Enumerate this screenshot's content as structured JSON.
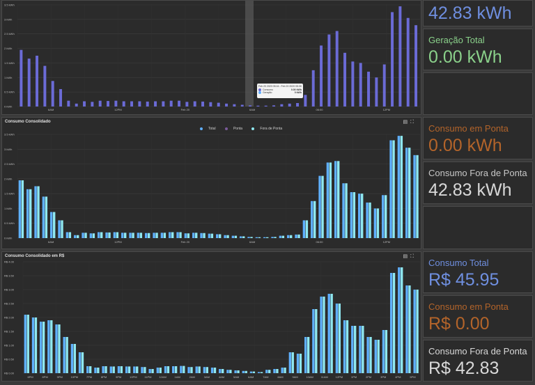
{
  "chart1": {
    "title": "",
    "tooltip": {
      "time": "Feb 20 2020 05:16 - Feb 20 2020 05:30",
      "rows": [
        {
          "name": "Consumo",
          "value": "0.00 kWh",
          "color": "#6b6bd6"
        },
        {
          "name": "Geração",
          "value": "0 kWh",
          "color": "#5fb0ff"
        }
      ]
    },
    "chart_data": {
      "type": "bar",
      "ylim": [
        0,
        3.5
      ],
      "yticks": [
        "0 kWh",
        "0.5 kWh",
        "1 kWh",
        "1.5 kWh",
        "2 kWh",
        "2.5 kWh",
        "3 kWh",
        "3.5 kWh"
      ],
      "xticks": [
        "6AM",
        "12PM",
        "Feb 20",
        "6AM",
        "06:00",
        "12PM"
      ],
      "series": [
        {
          "name": "Consumo",
          "color": "#6b6bd6",
          "values": [
            1.95,
            1.65,
            1.75,
            1.4,
            0.88,
            0.6,
            0.2,
            0.1,
            0.18,
            0.16,
            0.2,
            0.19,
            0.2,
            0.18,
            0.18,
            0.18,
            0.17,
            0.18,
            0.18,
            0.2,
            0.2,
            0.16,
            0.18,
            0.17,
            0.15,
            0.13,
            0.1,
            0.08,
            0.06,
            0.04,
            0.03,
            0.03,
            0.04,
            0.08,
            0.1,
            0.12,
            0.4,
            1.25,
            2.1,
            2.48,
            2.6,
            1.85,
            1.55,
            1.5,
            1.2,
            1.0,
            1.45,
            3.25,
            3.45,
            3.05,
            2.8
          ]
        }
      ]
    }
  },
  "chart2": {
    "title": "Consumo Consolidado",
    "legend": [
      {
        "name": "Total",
        "color": "#5fb0ff"
      },
      {
        "name": "Ponta",
        "color": "#7a5a9a"
      },
      {
        "name": "Fora de Ponta",
        "color": "#8fe8f0"
      }
    ],
    "chart_data": {
      "type": "bar",
      "ylim": [
        0,
        3.5
      ],
      "yticks": [
        "0 kWh",
        "0.5 kWh",
        "1 kWh",
        "1.5 kWh",
        "2 kWh",
        "2.5 kWh",
        "3 kWh",
        "3.5 kWh"
      ],
      "xticks": [
        "6AM",
        "12PM",
        "Feb 20",
        "6AM",
        "06:00",
        "12PM"
      ],
      "values": [
        1.95,
        1.65,
        1.75,
        1.4,
        0.88,
        0.6,
        0.2,
        0.1,
        0.18,
        0.16,
        0.2,
        0.19,
        0.2,
        0.18,
        0.18,
        0.18,
        0.17,
        0.18,
        0.18,
        0.2,
        0.2,
        0.16,
        0.18,
        0.17,
        0.15,
        0.13,
        0.1,
        0.08,
        0.06,
        0.04,
        0.03,
        0.03,
        0.04,
        0.08,
        0.1,
        0.12,
        0.6,
        1.25,
        2.1,
        2.55,
        2.6,
        1.85,
        1.55,
        1.5,
        1.2,
        1.0,
        1.45,
        3.3,
        3.45,
        3.05,
        2.8
      ]
    }
  },
  "chart3": {
    "title": "Consumo Consolidado em R$",
    "chart_data": {
      "type": "bar",
      "ylim": [
        0,
        4
      ],
      "yticks": [
        "R$ 0.00",
        "R$ 0.50",
        "R$ 1.00",
        "R$ 1.50",
        "R$ 2.00",
        "R$ 2.50",
        "R$ 3.00",
        "R$ 3.50",
        "R$ 4.00"
      ],
      "xticks": [
        "6PM",
        "8PM",
        "9PM",
        "10PM",
        "7PM",
        "8PM",
        "9PM",
        "10PM",
        "11PM",
        "12AM",
        "1AM",
        "2AM",
        "3AM",
        "4AM",
        "5AM",
        "6AM",
        "7AM",
        "8AM",
        "9AM",
        "10AM",
        "11AM",
        "12PM",
        "1PM",
        "2PM",
        "3PM",
        "4PM",
        "5PM"
      ],
      "values": [
        2.1,
        2.0,
        1.85,
        1.9,
        1.75,
        1.3,
        1.05,
        0.75,
        0.25,
        0.2,
        0.25,
        0.24,
        0.25,
        0.24,
        0.24,
        0.22,
        0.15,
        0.2,
        0.25,
        0.25,
        0.26,
        0.22,
        0.24,
        0.22,
        0.2,
        0.15,
        0.12,
        0.1,
        0.08,
        0.06,
        0.04,
        0.12,
        0.15,
        0.2,
        0.75,
        0.7,
        1.3,
        2.3,
        2.75,
        2.85,
        2.5,
        1.9,
        1.7,
        1.7,
        1.3,
        1.2,
        1.55,
        3.6,
        3.8,
        3.15,
        3.0
      ]
    }
  },
  "cards": [
    {
      "label": "",
      "value": "42.83 kWh",
      "label_color": "#6f8fe0",
      "value_color": "#6f8fe0"
    },
    {
      "label": "Geração Total",
      "value": "0.00 kWh",
      "label_color": "#8ad08a",
      "value_color": "#8ad08a"
    },
    {
      "label": "",
      "value": "",
      "label_color": "#ffffff",
      "value_color": "#ffffff"
    },
    {
      "label": "Consumo em Ponta",
      "value": "0.00 kWh",
      "label_color": "#b3642a",
      "value_color": "#b3642a"
    },
    {
      "label": "Consumo Fora de Ponta",
      "value": "42.83 kWh",
      "label_color": "#c8c8c8",
      "value_color": "#d8d8d8"
    },
    {
      "label": "",
      "value": "",
      "label_color": "#ffffff",
      "value_color": "#ffffff"
    },
    {
      "label": "Consumo Total",
      "value": "R$ 45.95",
      "label_color": "#6f8fe0",
      "value_color": "#6f8fe0"
    },
    {
      "label": "Consumo em Ponta",
      "value": "R$ 0.00",
      "label_color": "#b3642a",
      "value_color": "#b3642a"
    },
    {
      "label": "Consumo Fora de Ponta",
      "value": "R$ 42.83",
      "label_color": "#d8d8d8",
      "value_color": "#d8d8d8"
    }
  ]
}
